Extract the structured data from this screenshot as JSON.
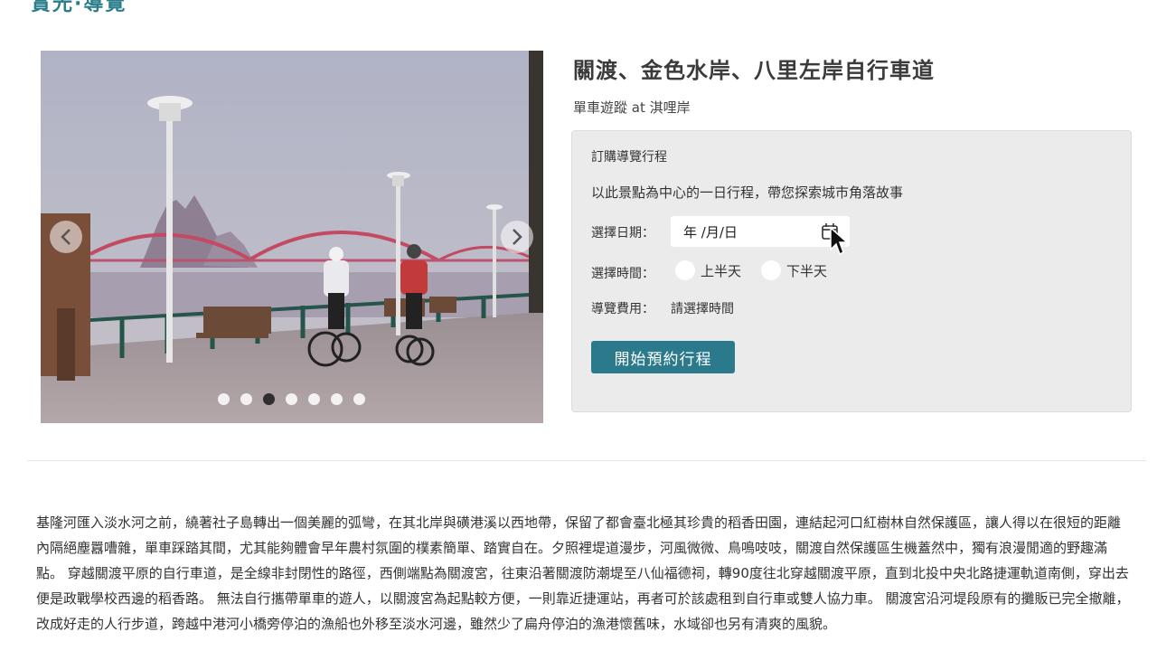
{
  "header": {
    "cut_title": "賞光·導覽"
  },
  "carousel": {
    "slide_count": 7,
    "active_index": 2
  },
  "tour": {
    "title": "關渡、金色水岸、八里左岸自行車道",
    "subtitle": "單車遊蹤 at 淇哩岸"
  },
  "booking": {
    "heading": "訂購導覽行程",
    "description": "以此景點為中心的一日行程，帶您探索城市角落故事",
    "date_label": "選擇日期：",
    "date_value": "年 /月/日",
    "time_label": "選擇時間：",
    "time_options": [
      "上半天",
      "下半天"
    ],
    "fee_label": "導覽費用：",
    "fee_value": "請選擇時間",
    "submit_label": "開始預約行程"
  },
  "description": "基隆河匯入淡水河之前，繞著社子島轉出一個美麗的弧彎，在其北岸與磺港溪以西地帶，保留了都會臺北極其珍貴的稻香田園，連結起河口紅樹林自然保護區，讓人得以在很短的距離內隔絕塵囂嘈雜，單車踩踏其間，尤其能夠體會早年農村氛圍的樸素簡單、踏實自在。夕照裡堤道漫步，河風微微、鳥鳴吱吱，關渡自然保護區生機蓋然中，獨有浪漫閒適的野趣滿點。 穿越關渡平原的自行車道，是全線非封閉性的路徑，西側端點為關渡宮，往東沿著關渡防潮堤至八仙福德祠，轉90度往北穿越關渡平原，直到北投中央北路捷運軌道南側，穿出去便是政戰學校西邊的稻香路。 無法自行攜帶單車的遊人，以關渡宮為起點較方便，一則靠近捷運站，再者可於該處租到自行車或雙人協力車。 關渡宮沿河堤段原有的攤販已完全撤離，改成好走的人行步道，跨越中港河小橋旁停泊的漁船也外移至淡水河邊，雖然少了扁舟停泊的漁港懷舊味，水域卻也另有清爽的風貌。",
  "colors": {
    "accent": "#2b7a8c",
    "panel_bg": "#ebebeb",
    "title_text": "#3b3b3b"
  }
}
